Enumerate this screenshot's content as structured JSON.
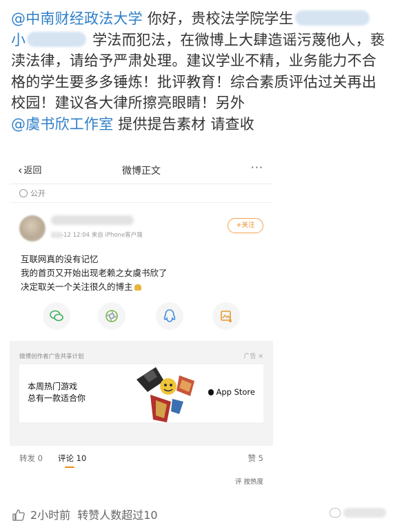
{
  "post": {
    "mention_school": "@中南财经政法大学",
    "line1_text": " 你好，贵校法学院学生",
    "name_prefix": "小",
    "line2_text": " 学法而犯法，在微博上大肆造谣污蔑他人，亵渎法律，请给予严肃处理。建议学业不精，业务能力不合格的学生要多多锤炼！批评教育！综合素质评估过关再出校园！建议各大律所擦亮眼睛！另外",
    "mention_studio": "@虞书欣工作室",
    "line3_text": " 提供提告素材 请查收"
  },
  "screenshot": {
    "nav": {
      "back_label": "返回",
      "title": "微博正文",
      "more_label": "···"
    },
    "visibility_label": "公开",
    "card": {
      "meta": "-12 12:04  来自 iPhone客户端",
      "follow_label": "+关注",
      "lines": [
        "互联网真的没有记忆",
        "我的首页又开始出现老赖之女虞书欣了",
        "决定取关一个关注很久的博主"
      ]
    },
    "share_icons": [
      "wechat-icon",
      "moments-icon",
      "qq-icon",
      "save-image-icon"
    ],
    "ad": {
      "label": "微博创作者广告共享计划",
      "tag": "广告",
      "tag_close": "✕",
      "line1": "本周热门游戏",
      "line2": "总有一款适合你",
      "store": "App Store"
    },
    "stats": {
      "repost": "转发 0",
      "comment": "评论 10",
      "like": "赞 5",
      "sort": "评 按热度"
    }
  },
  "footer": {
    "time": "2小时前",
    "likes": "转赞人数超过10"
  },
  "colors": {
    "mention": "#2f7fc8",
    "accent_orange": "#f08a1d"
  }
}
